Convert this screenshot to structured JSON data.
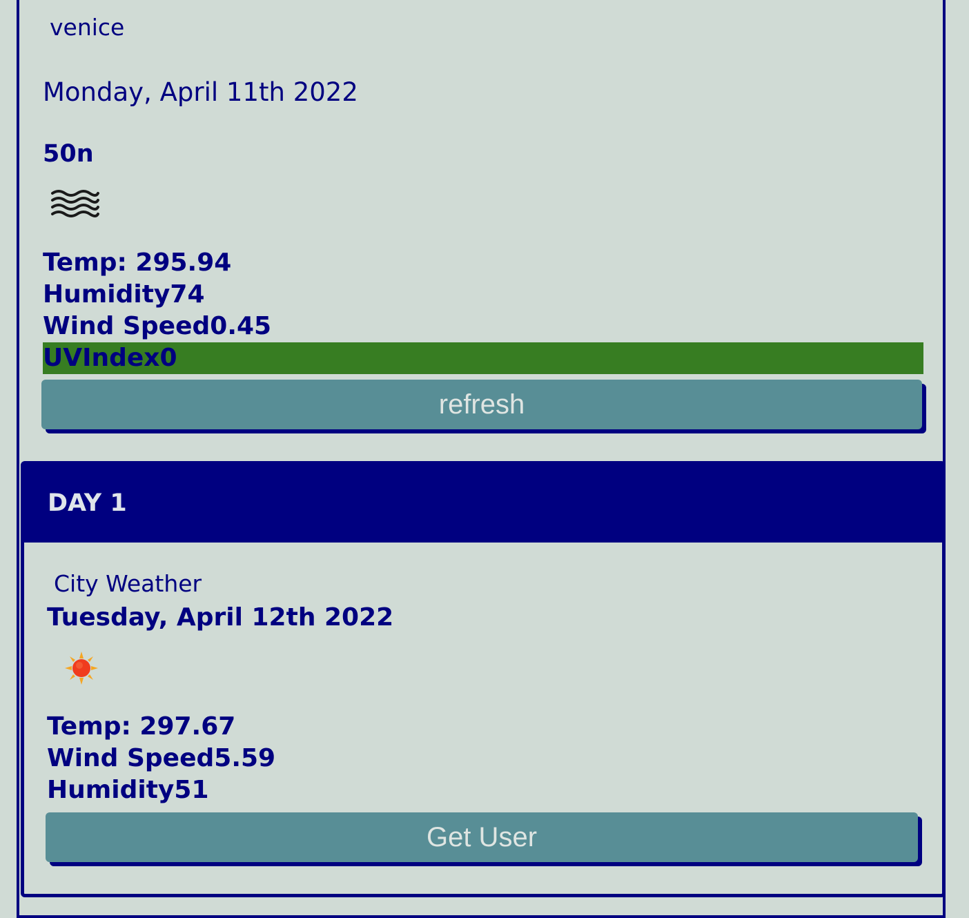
{
  "current": {
    "city": "venice",
    "date": "Monday, April 11th 2022",
    "icon_code": "50n",
    "icon": "mist-icon",
    "temp": "Temp: 295.94",
    "humidity": "Humidity74",
    "wind_speed": "Wind Speed0.45",
    "uv_index": "UVIndex0",
    "uv_color": "#377d22",
    "refresh_label": "refresh"
  },
  "forecast": {
    "header": "DAY 1",
    "city_label": "City Weather",
    "date": "Tuesday, April 12th 2022",
    "icon": "sun-icon",
    "temp": "Temp: 297.67",
    "wind_speed": "Wind Speed5.59",
    "humidity": "Humidity51",
    "button_label": "Get User"
  },
  "colors": {
    "background": "#d0dbd5",
    "accent": "#000080",
    "button": "#588e96"
  }
}
